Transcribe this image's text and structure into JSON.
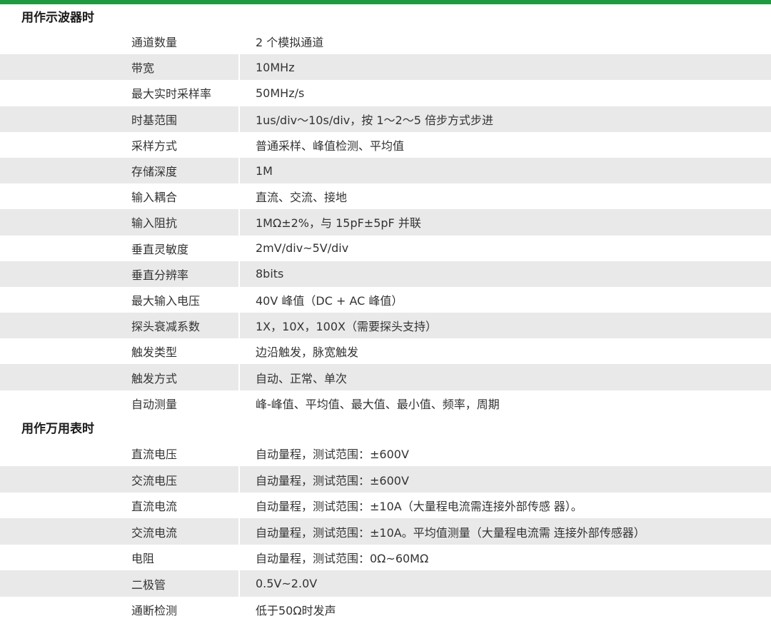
{
  "colors": {
    "accent": "#1f9a3f",
    "row_shade": "#e9e9e9"
  },
  "sections": [
    {
      "title": "用作示波器时",
      "rows": [
        {
          "label": "通道数量",
          "value": "2 个模拟通道"
        },
        {
          "label": "带宽",
          "value": "10MHz"
        },
        {
          "label": "最大实时采样率",
          "value": "50MHz/s"
        },
        {
          "label": "时基范围",
          "value": "1us/div～10s/div，按 1～2～5 倍步方式步进"
        },
        {
          "label": "采样方式",
          "value": "普通采样、峰值检测、平均值"
        },
        {
          "label": "存储深度",
          "value": "1M"
        },
        {
          "label": "输入耦合",
          "value": "直流、交流、接地"
        },
        {
          "label": "输入阻抗",
          "value": "1MΩ±2%，与 15pF±5pF 并联"
        },
        {
          "label": "垂直灵敏度",
          "value": "2mV/div~5V/div"
        },
        {
          "label": "垂直分辨率",
          "value": "8bits"
        },
        {
          "label": "最大输入电压",
          "value": "40V 峰值（DC + AC 峰值）"
        },
        {
          "label": "探头衰减系数",
          "value": "1X，10X，100X（需要探头支持）"
        },
        {
          "label": "触发类型",
          "value": "边沿触发，脉宽触发"
        },
        {
          "label": "触发方式",
          "value": "自动、正常、单次"
        },
        {
          "label": "自动测量",
          "value": "峰-峰值、平均值、最大值、最小值、频率，周期"
        }
      ]
    },
    {
      "title": "用作万用表时",
      "rows": [
        {
          "label": "直流电压",
          "value": "自动量程，测试范围：±600V"
        },
        {
          "label": "交流电压",
          "value": "自动量程，测试范围：±600V"
        },
        {
          "label": "直流电流",
          "value": "自动量程，测试范围：±10A（大量程电流需连接外部传感 器）。"
        },
        {
          "label": "交流电流",
          "value": "自动量程，测试范围：±10A。平均值测量（大量程电流需 连接外部传感器）"
        },
        {
          "label": "电阻",
          "value": "自动量程，测试范围：0Ω~60MΩ"
        },
        {
          "label": "二极管",
          "value": "0.5V~2.0V"
        },
        {
          "label": "通断检测",
          "value": "低于50Ω时发声"
        }
      ]
    }
  ]
}
